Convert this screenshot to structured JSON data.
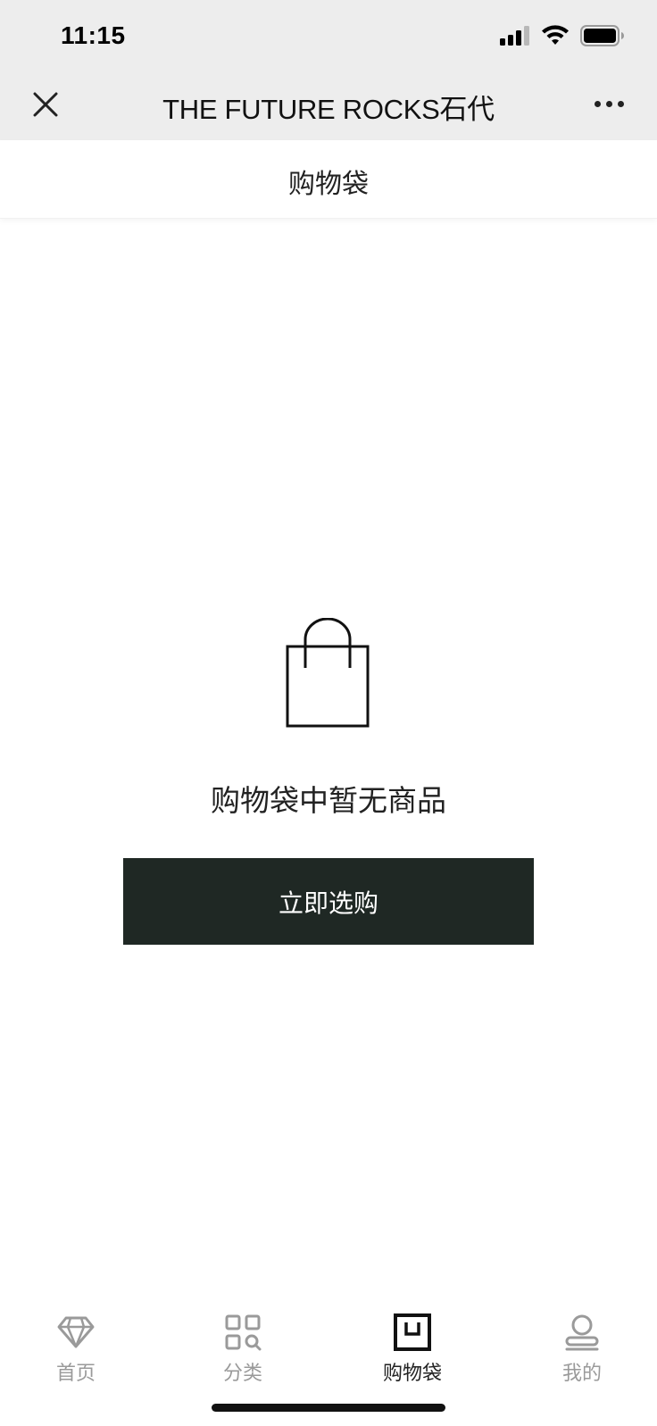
{
  "status_bar": {
    "time": "11:15"
  },
  "nav_bar": {
    "title": "THE FUTURE ROCKS石代"
  },
  "page": {
    "title": "购物袋"
  },
  "empty_state": {
    "message": "购物袋中暂无商品",
    "button_label": "立即选购"
  },
  "tabbar": {
    "items": [
      {
        "label": "首页",
        "icon": "diamond-icon"
      },
      {
        "label": "分类",
        "icon": "category-grid-icon"
      },
      {
        "label": "购物袋",
        "icon": "shopping-bag-icon",
        "active": true
      },
      {
        "label": "我的",
        "icon": "user-icon"
      }
    ]
  },
  "colors": {
    "accent": "#1f2824",
    "inactive_tab": "#9a9a9a",
    "topbar_bg": "#ededed"
  }
}
